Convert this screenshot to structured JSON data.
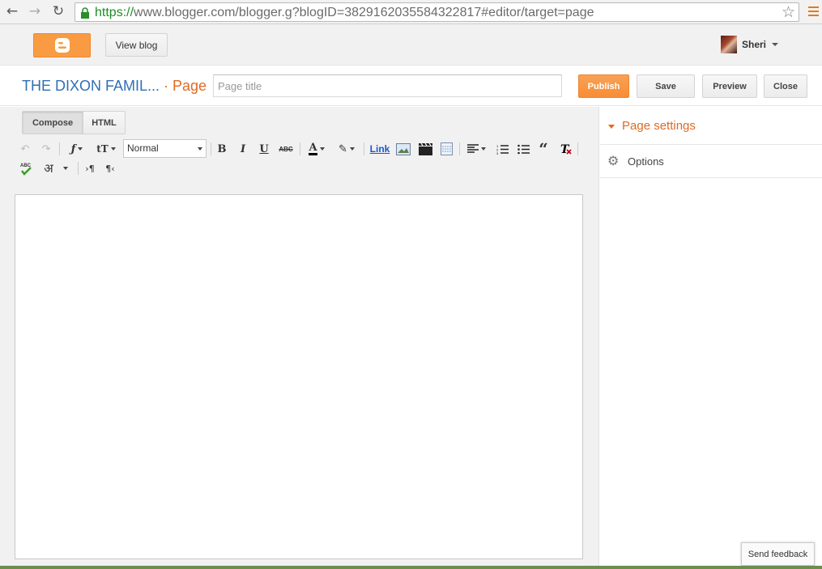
{
  "browser": {
    "url_scheme": "https://",
    "url_rest": "www.blogger.com/blogger.g?blogID=3829162035584322817#editor/target=page"
  },
  "header": {
    "view_blog_label": "View blog",
    "user_name": "Sheri"
  },
  "title_bar": {
    "blog_name": "THE DIXON FAMIL...",
    "page_label": "· Page",
    "page_title_placeholder": "Page title",
    "page_title_value": "",
    "publish_label": "Publish",
    "save_label": "Save",
    "preview_label": "Preview",
    "close_label": "Close"
  },
  "editor": {
    "tabs": [
      {
        "label": "Compose",
        "active": true
      },
      {
        "label": "HTML",
        "active": false
      }
    ],
    "format_value": "Normal",
    "link_label": "Link",
    "body_text": ""
  },
  "sidebar": {
    "section_title": "Page settings",
    "options_label": "Options"
  },
  "feedback_label": "Send feedback",
  "colors": {
    "accent_orange": "#f78d35",
    "blog_name_blue": "#2f6fb4",
    "settings_orange": "#dd6a23"
  }
}
